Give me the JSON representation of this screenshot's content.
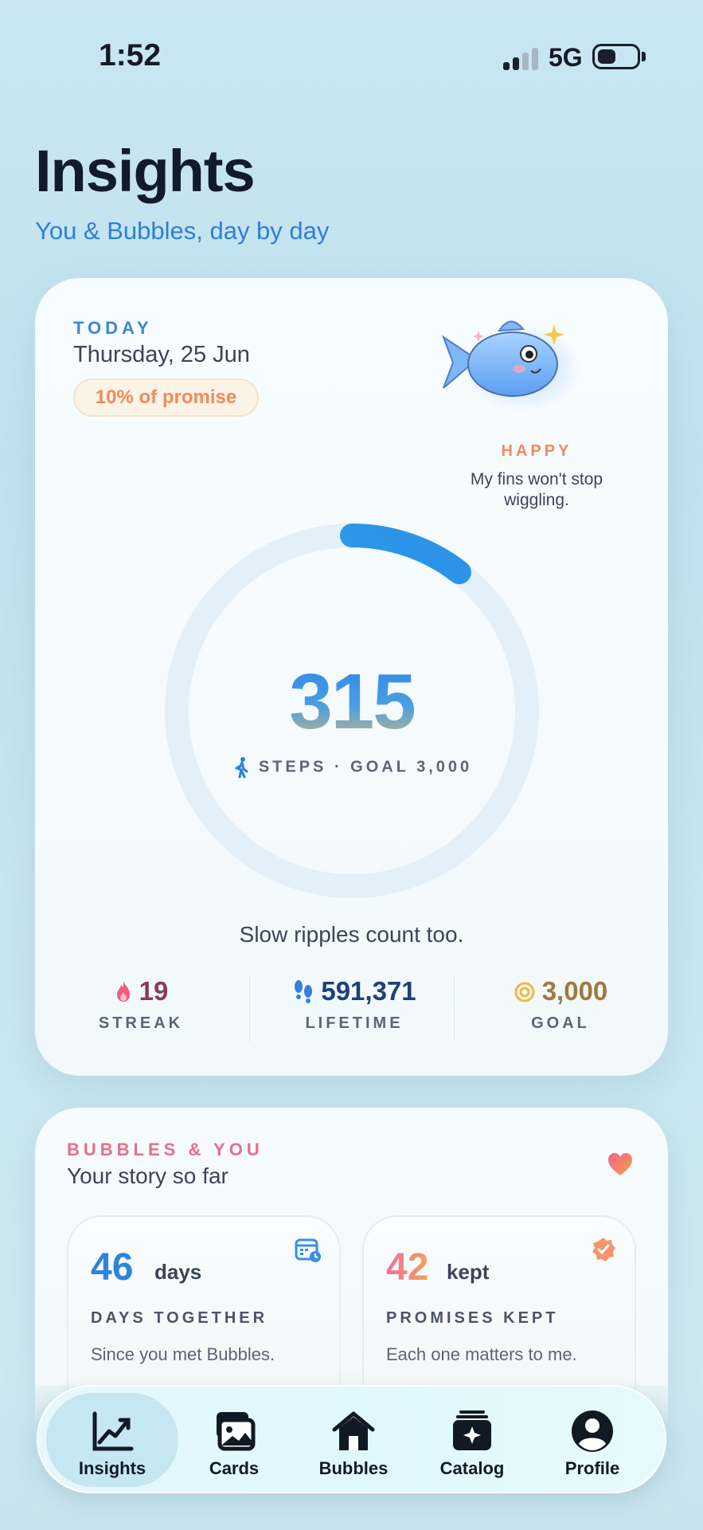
{
  "status_bar": {
    "time": "1:52",
    "network": "5G"
  },
  "header": {
    "title": "Insights",
    "subtitle": "You & Bubbles, day by day"
  },
  "today": {
    "label": "TODAY",
    "date": "Thursday, 25 Jun",
    "promise_badge": "10% of promise",
    "mood_label": "HAPPY",
    "mood_text": "My fins won't stop wiggling.",
    "steps": "315",
    "steps_caption": "STEPS · GOAL 3,000",
    "progress_fraction": 0.105,
    "encouragement": "Slow ripples count too.",
    "stats": [
      {
        "value": "19",
        "label": "STREAK",
        "icon": "flame-icon",
        "color": "#e0456f"
      },
      {
        "value": "591,371",
        "label": "LIFETIME",
        "icon": "footprints-icon",
        "color": "#1f3f7a"
      },
      {
        "value": "3,000",
        "label": "GOAL",
        "icon": "target-icon",
        "color": "#a07a3e"
      }
    ]
  },
  "story": {
    "label": "BUBBLES & YOU",
    "title": "Your story so far",
    "cards": [
      {
        "number": "46",
        "unit": "days",
        "label": "DAYS TOGETHER",
        "desc": "Since you met Bubbles.",
        "icon": "calendar-icon"
      },
      {
        "number": "42",
        "unit": "kept",
        "label": "PROMISES KEPT",
        "desc": "Each one matters to me.",
        "icon": "badge-check-icon"
      }
    ]
  },
  "nav": {
    "items": [
      {
        "label": "Insights",
        "icon": "chart-icon",
        "active": true
      },
      {
        "label": "Cards",
        "icon": "photos-icon",
        "active": false
      },
      {
        "label": "Bubbles",
        "icon": "home-icon",
        "active": false
      },
      {
        "label": "Catalog",
        "icon": "catalog-icon",
        "active": false
      },
      {
        "label": "Profile",
        "icon": "profile-icon",
        "active": false
      }
    ]
  },
  "colors": {
    "accent": "#2f7fd6",
    "promise": "#f08b5c",
    "story_accent": "#e66f8c"
  }
}
